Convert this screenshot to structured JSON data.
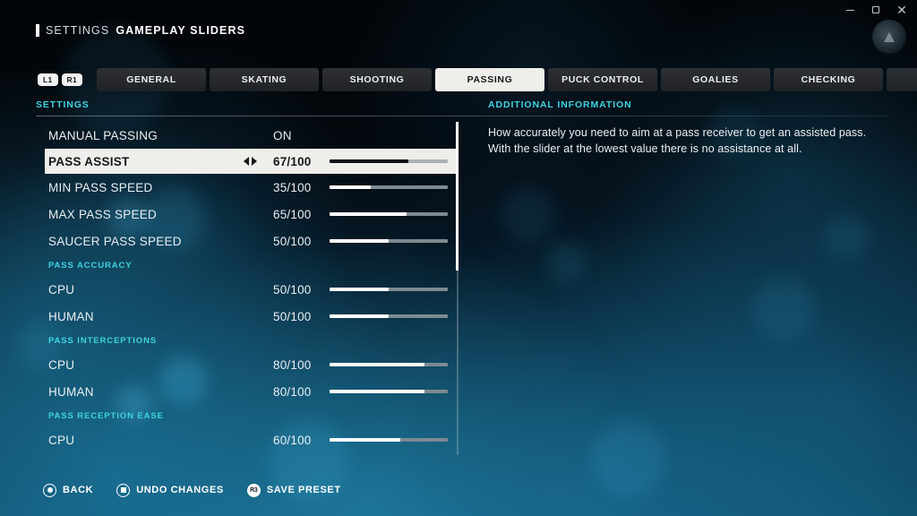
{
  "window": {
    "minimize_label": "minimize",
    "maximize_label": "maximize",
    "close_label": "✕"
  },
  "header": {
    "title_light": "SETTINGS",
    "title_bold": "GAMEPLAY SLIDERS"
  },
  "tabbar": {
    "bumpers": [
      {
        "label": "L1"
      },
      {
        "label": "R1"
      }
    ],
    "tabs": [
      {
        "label": "GENERAL",
        "active": false
      },
      {
        "label": "SKATING",
        "active": false
      },
      {
        "label": "SHOOTING",
        "active": false
      },
      {
        "label": "PASSING",
        "active": true
      },
      {
        "label": "PUCK CONTROL",
        "active": false
      },
      {
        "label": "GOALIES",
        "active": false
      },
      {
        "label": "CHECKING",
        "active": false
      },
      {
        "label": "",
        "active": false
      }
    ]
  },
  "sections": {
    "settings_label": "SETTINGS",
    "info_label": "ADDITIONAL INFORMATION"
  },
  "settings": {
    "rows": [
      {
        "kind": "option",
        "label": "MANUAL PASSING",
        "value": "ON",
        "selected": false
      },
      {
        "kind": "slider",
        "label": "PASS ASSIST",
        "value": "67/100",
        "percent": 67,
        "selected": true
      },
      {
        "kind": "slider",
        "label": "MIN PASS SPEED",
        "value": "35/100",
        "percent": 35,
        "selected": false
      },
      {
        "kind": "slider",
        "label": "MAX PASS SPEED",
        "value": "65/100",
        "percent": 65,
        "selected": false
      },
      {
        "kind": "slider",
        "label": "SAUCER PASS SPEED",
        "value": "50/100",
        "percent": 50,
        "selected": false
      },
      {
        "kind": "group",
        "label": "PASS ACCURACY"
      },
      {
        "kind": "slider",
        "label": "CPU",
        "value": "50/100",
        "percent": 50,
        "selected": false
      },
      {
        "kind": "slider",
        "label": "HUMAN",
        "value": "50/100",
        "percent": 50,
        "selected": false
      },
      {
        "kind": "group",
        "label": "PASS INTERCEPTIONS"
      },
      {
        "kind": "slider",
        "label": "CPU",
        "value": "80/100",
        "percent": 80,
        "selected": false
      },
      {
        "kind": "slider",
        "label": "HUMAN",
        "value": "80/100",
        "percent": 80,
        "selected": false
      },
      {
        "kind": "group",
        "label": "PASS RECEPTION EASE"
      },
      {
        "kind": "slider",
        "label": "CPU",
        "value": "60/100",
        "percent": 60,
        "selected": false
      }
    ]
  },
  "info": {
    "text": "How accurately you need to aim at a pass receiver to get an assisted pass. With the slider at the lowest value there is no assistance at all."
  },
  "prompts": [
    {
      "icon": "circle-button-icon",
      "label": "BACK"
    },
    {
      "icon": "square-button-icon",
      "label": "UNDO CHANGES"
    },
    {
      "icon": "r3-stick-icon",
      "label": "SAVE PRESET",
      "badge": "R3"
    }
  ],
  "colors": {
    "accent_cyan": "#3fd3df",
    "selection_bg": "#efeeeb",
    "slider_fill": "#ffffff",
    "slider_track": "#7c8a92"
  }
}
